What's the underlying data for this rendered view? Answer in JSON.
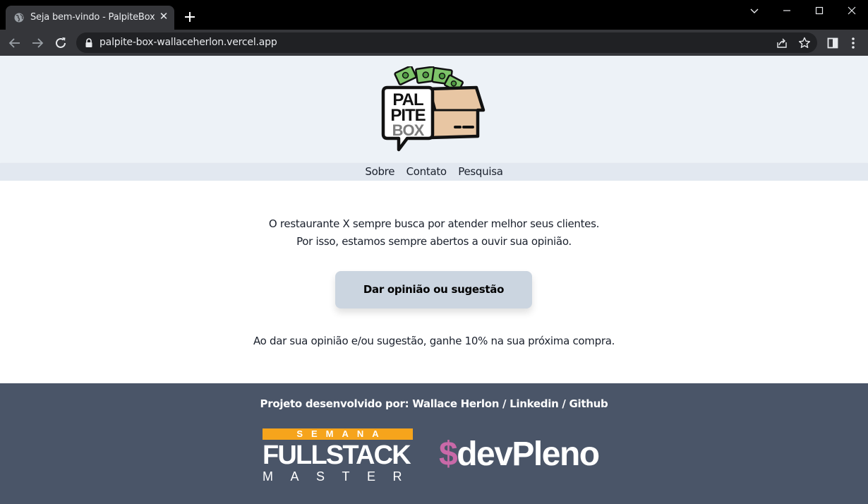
{
  "browser": {
    "tab_title": "Seja bem-vindo - PalpiteBox",
    "url": "palpite-box-wallaceherlon.vercel.app",
    "icons": [
      "globe-icon",
      "close-icon",
      "plus-icon",
      "chevron-down-icon",
      "minimize-icon",
      "maximize-icon",
      "close-window-icon",
      "back-icon",
      "forward-icon",
      "reload-icon",
      "lock-icon",
      "share-icon",
      "star-icon",
      "side-panel-icon",
      "kebab-menu-icon"
    ]
  },
  "header": {
    "logo": {
      "line1": "PAL",
      "line2": "PITE",
      "line3": "BOX"
    },
    "nav": [
      {
        "label": "Sobre"
      },
      {
        "label": "Contato"
      },
      {
        "label": "Pesquisa"
      }
    ]
  },
  "main": {
    "intro_line1": "O restaurante X sempre busca por atender melhor seus clientes.",
    "intro_line2": "Por isso, estamos sempre abertos a ouvir sua opinião.",
    "cta_label": "Dar opinião ou sugestão",
    "promo": "Ao dar sua opinião e/ou sugestão, ganhe 10% na sua próxima compra."
  },
  "footer": {
    "credits_prefix": "Projeto desenvolvido por:",
    "author": "Wallace Herlon",
    "sep1": "/",
    "linkedin": "Linkedin",
    "sep2": "/",
    "github": "Github",
    "fsm": {
      "top": "SEMANA",
      "main": "FULLSTACK",
      "bottom": "MASTER"
    },
    "devpleno": {
      "dollar": "$",
      "name": "devPleno"
    }
  },
  "colors": {
    "header_bg": "#edf2f7",
    "nav_bg": "#e2e8f0",
    "button_bg": "#cbd5e0",
    "footer_bg": "#4a5568",
    "fsm_accent": "#f6a41c",
    "devpleno_accent": "#c969a8"
  }
}
